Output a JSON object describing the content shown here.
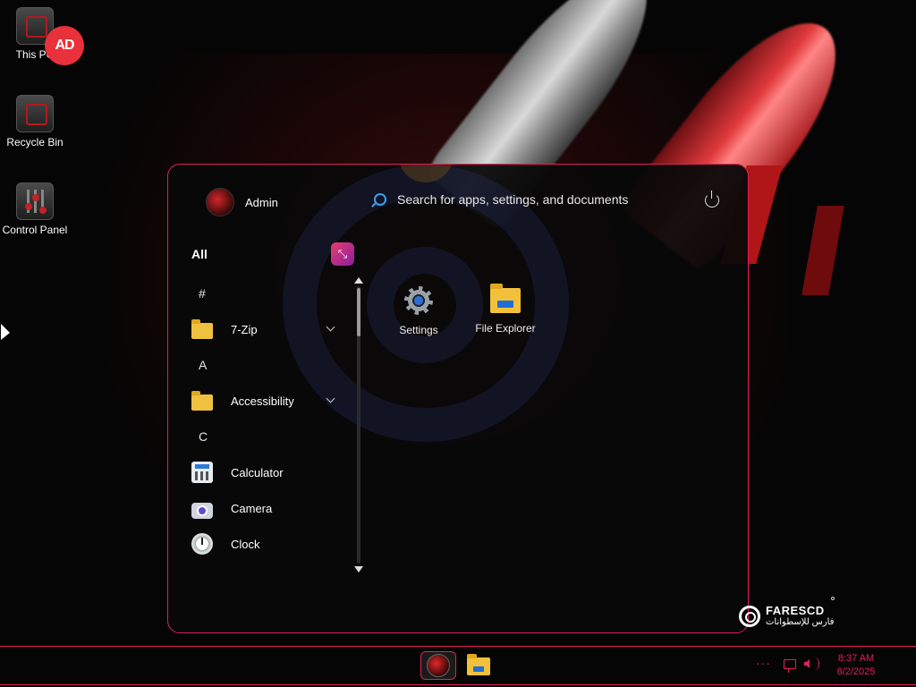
{
  "desktop": {
    "icons": [
      {
        "label": "This PC",
        "icon": "computer-icon"
      },
      {
        "label": "Recycle Bin",
        "icon": "recycle-bin-icon"
      },
      {
        "label": "Control Panel",
        "icon": "control-panel-icon"
      }
    ],
    "badge": {
      "text": "AD",
      "color": "#e8313a"
    }
  },
  "start_menu": {
    "user": {
      "name": "Admin"
    },
    "search": {
      "placeholder": "Search for apps, settings, and documents"
    },
    "all_label": "All",
    "app_list": [
      {
        "type": "letter",
        "label": "#"
      },
      {
        "type": "app",
        "label": "7-Zip",
        "icon": "folder-icon",
        "expandable": true
      },
      {
        "type": "letter",
        "label": "A"
      },
      {
        "type": "app",
        "label": "Accessibility",
        "icon": "folder-icon",
        "expandable": true
      },
      {
        "type": "letter",
        "label": "C"
      },
      {
        "type": "app",
        "label": "Calculator",
        "icon": "calculator-icon"
      },
      {
        "type": "app",
        "label": "Camera",
        "icon": "camera-icon"
      },
      {
        "type": "app",
        "label": "Clock",
        "icon": "clock-icon"
      }
    ],
    "pinned": [
      {
        "label": "Settings",
        "icon": "gear-icon"
      },
      {
        "label": "File Explorer",
        "icon": "file-explorer-icon"
      }
    ],
    "accent_color": "#e0205a"
  },
  "branding": {
    "name": "FARESCD",
    "subtitle": "فارس للإسطوانات"
  },
  "taskbar": {
    "more": "···",
    "time": "8:37 AM",
    "date": "6/2/2025",
    "accent_color": "#e0205a"
  }
}
